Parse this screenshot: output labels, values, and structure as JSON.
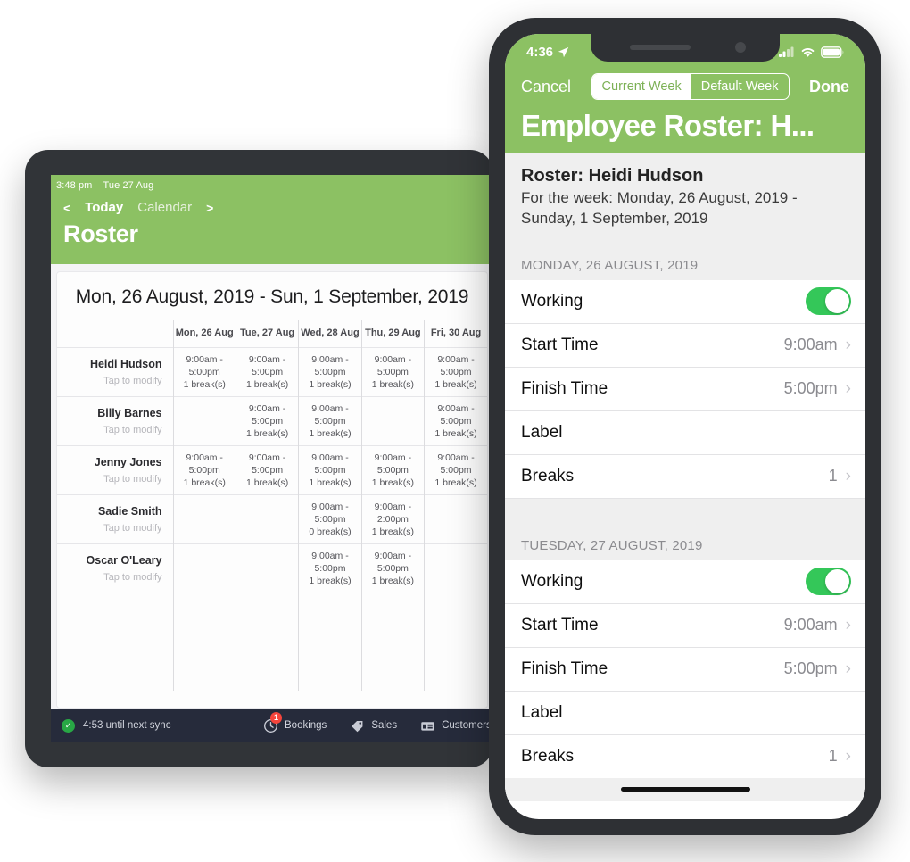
{
  "tablet": {
    "status_bar": {
      "time": "3:48 pm",
      "date": "Tue 27 Aug"
    },
    "nav": {
      "prev": "<",
      "today": "Today",
      "calendar": "Calendar",
      "next": ">"
    },
    "title": "Roster",
    "date_range": "Mon, 26 August, 2019 - Sun, 1 September, 2019",
    "columns": [
      "",
      "Mon, 26 Aug",
      "Tue, 27 Aug",
      "Wed, 28 Aug",
      "Thu, 29 Aug",
      "Fri, 30 Aug"
    ],
    "row_subtitle": "Tap to modify",
    "rows": [
      {
        "name": "Heidi Hudson",
        "cells": [
          {
            "time": "9:00am - 5:00pm",
            "breaks": "1 break(s)"
          },
          {
            "time": "9:00am - 5:00pm",
            "breaks": "1 break(s)"
          },
          {
            "time": "9:00am - 5:00pm",
            "breaks": "1 break(s)"
          },
          {
            "time": "9:00am - 5:00pm",
            "breaks": "1 break(s)"
          },
          {
            "time": "9:00am - 5:00pm",
            "breaks": "1 break(s)"
          }
        ]
      },
      {
        "name": "Billy Barnes",
        "cells": [
          {
            "time": "",
            "breaks": ""
          },
          {
            "time": "9:00am - 5:00pm",
            "breaks": "1 break(s)"
          },
          {
            "time": "9:00am - 5:00pm",
            "breaks": "1 break(s)"
          },
          {
            "time": "",
            "breaks": ""
          },
          {
            "time": "9:00am - 5:00pm",
            "breaks": "1 break(s)"
          }
        ]
      },
      {
        "name": "Jenny Jones",
        "cells": [
          {
            "time": "9:00am - 5:00pm",
            "breaks": "1 break(s)"
          },
          {
            "time": "9:00am - 5:00pm",
            "breaks": "1 break(s)"
          },
          {
            "time": "9:00am - 5:00pm",
            "breaks": "1 break(s)"
          },
          {
            "time": "9:00am - 5:00pm",
            "breaks": "1 break(s)"
          },
          {
            "time": "9:00am - 5:00pm",
            "breaks": "1 break(s)"
          }
        ]
      },
      {
        "name": "Sadie Smith",
        "cells": [
          {
            "time": "",
            "breaks": ""
          },
          {
            "time": "",
            "breaks": ""
          },
          {
            "time": "9:00am - 5:00pm",
            "breaks": "0 break(s)"
          },
          {
            "time": "9:00am - 2:00pm",
            "breaks": "1 break(s)"
          },
          {
            "time": "",
            "breaks": ""
          }
        ]
      },
      {
        "name": "Oscar O'Leary",
        "cells": [
          {
            "time": "",
            "breaks": ""
          },
          {
            "time": "",
            "breaks": ""
          },
          {
            "time": "9:00am - 5:00pm",
            "breaks": "1 break(s)"
          },
          {
            "time": "9:00am - 5:00pm",
            "breaks": "1 break(s)"
          },
          {
            "time": "",
            "breaks": ""
          }
        ]
      },
      {
        "name": "",
        "cells": [
          {
            "time": "",
            "breaks": ""
          },
          {
            "time": "",
            "breaks": ""
          },
          {
            "time": "",
            "breaks": ""
          },
          {
            "time": "",
            "breaks": ""
          },
          {
            "time": "",
            "breaks": ""
          }
        ]
      },
      {
        "name": "",
        "cells": [
          {
            "time": "",
            "breaks": ""
          },
          {
            "time": "",
            "breaks": ""
          },
          {
            "time": "",
            "breaks": ""
          },
          {
            "time": "",
            "breaks": ""
          },
          {
            "time": "",
            "breaks": ""
          }
        ]
      }
    ],
    "toolbar": {
      "sync_text": "4:53 until next sync",
      "items": [
        {
          "label": "Bookings",
          "icon": "clock-icon",
          "badge": "1"
        },
        {
          "label": "Sales",
          "icon": "tag-icon",
          "badge": ""
        },
        {
          "label": "Customers",
          "icon": "storefront-icon",
          "badge": ""
        }
      ]
    }
  },
  "phone": {
    "status_bar": {
      "time": "4:36",
      "location_icon": "location-arrow-icon"
    },
    "navbar": {
      "cancel": "Cancel",
      "done": "Done"
    },
    "segment": {
      "options": [
        "Current Week",
        "Default Week"
      ],
      "selected": "Current Week"
    },
    "title": "Employee Roster: H...",
    "info": {
      "title": "Roster: Heidi Hudson",
      "subtitle": "For the week: Monday, 26 August, 2019 - Sunday, 1 September, 2019"
    },
    "sections": [
      {
        "header": "MONDAY, 26 AUGUST, 2019",
        "rows": [
          {
            "label": "Working",
            "type": "toggle",
            "value": "on",
            "chevron": false
          },
          {
            "label": "Start Time",
            "type": "value",
            "value": "9:00am",
            "chevron": true
          },
          {
            "label": "Finish Time",
            "type": "value",
            "value": "5:00pm",
            "chevron": true
          },
          {
            "label": "Label",
            "type": "value",
            "value": "",
            "chevron": false
          },
          {
            "label": "Breaks",
            "type": "value",
            "value": "1",
            "chevron": true
          }
        ]
      },
      {
        "header": "TUESDAY, 27 AUGUST, 2019",
        "rows": [
          {
            "label": "Working",
            "type": "toggle",
            "value": "on",
            "chevron": false
          },
          {
            "label": "Start Time",
            "type": "value",
            "value": "9:00am",
            "chevron": true
          },
          {
            "label": "Finish Time",
            "type": "value",
            "value": "5:00pm",
            "chevron": true
          },
          {
            "label": "Label",
            "type": "value",
            "value": "",
            "chevron": false
          },
          {
            "label": "Breaks",
            "type": "value",
            "value": "1",
            "chevron": true
          }
        ]
      }
    ]
  },
  "colors": {
    "brand_green": "#8cc163",
    "toggle_green": "#34c759",
    "toolbar_dark": "#262b3b",
    "badge_red": "#f4453c",
    "device_frame": "#2e3034"
  }
}
